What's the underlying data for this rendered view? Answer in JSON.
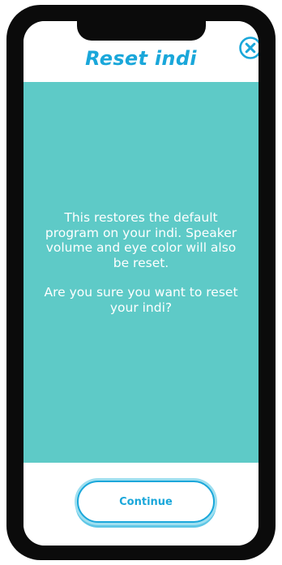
{
  "header": {
    "title": "Reset indi",
    "close_icon": "close-circle-icon"
  },
  "dialog": {
    "message_paragraph_1": "This restores the default program on your indi. Speaker volume and eye color will also be reset.",
    "message_paragraph_2": "Are you sure you want to reset your indi?"
  },
  "footer": {
    "continue_label": "Continue"
  },
  "colors": {
    "accent": "#1aa7da",
    "panel": "#5ecac7",
    "phone_frame": "#0b0b0b"
  }
}
